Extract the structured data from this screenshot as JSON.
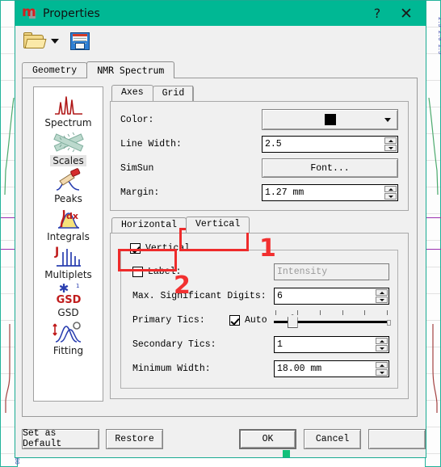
{
  "window": {
    "title": "Properties",
    "logo_icon": "mestrenova-m-logo",
    "help_label": "?",
    "close_label": "✕",
    "titlebar_color": "#00b894",
    "border_color": "#1aab92"
  },
  "toolbar": {
    "open_icon": "open-folder-icon",
    "open_dropdown_icon": "chevron-down-icon",
    "save_icon": "floppy-save-icon"
  },
  "outer_tabs": [
    {
      "label": "Geometry",
      "active": false
    },
    {
      "label": "NMR Spectrum",
      "active": true
    }
  ],
  "sidebar": {
    "items": [
      {
        "label": "Spectrum",
        "icon": "spectrum-icon",
        "selected": false
      },
      {
        "label": "Scales",
        "icon": "scales-ruler-icon",
        "selected": true
      },
      {
        "label": "Peaks",
        "icon": "peaks-hand-icon",
        "selected": false
      },
      {
        "label": "Integrals",
        "icon": "integrals-icon",
        "selected": false
      },
      {
        "label": "Multiplets",
        "icon": "multiplets-icon",
        "selected": false
      },
      {
        "label": "GSD",
        "icon": "gsd-icon",
        "selected": false
      },
      {
        "label": "Fitting",
        "icon": "fitting-icon",
        "selected": false
      }
    ]
  },
  "inner_tabs": [
    {
      "label": "Axes",
      "active": true
    },
    {
      "label": "Grid",
      "active": false
    }
  ],
  "axes": {
    "color": {
      "label": "Color:",
      "value_color": "#000000",
      "caret_icon": "chevron-down-icon"
    },
    "line_width": {
      "label": "Line Width:",
      "value": "2.5"
    },
    "font": {
      "label": "SimSun",
      "button_label": "Font..."
    },
    "margin": {
      "label": "Margin:",
      "value": "1.27 mm"
    }
  },
  "axis_tabs": [
    {
      "label": "Horizontal",
      "active": false
    },
    {
      "label": "Vertical",
      "active": true
    }
  ],
  "vertical": {
    "enabled_label": "Vertical",
    "enabled_checked": true,
    "label_row": {
      "label": "Label:",
      "checked": false,
      "value": "Intensity"
    },
    "max_significant_digits": {
      "label": "Max. Significant Digits:",
      "value": "6"
    },
    "primary_tics": {
      "label": "Primary Tics:",
      "auto_label": "Auto",
      "auto_checked": true,
      "slider_ticks": 6,
      "slider_position_pct": 16
    },
    "secondary_tics": {
      "label": "Secondary Tics:",
      "value": "1"
    },
    "minimum_width": {
      "label": "Minimum Width:",
      "value": "18.00 mm"
    }
  },
  "annotations": [
    {
      "name": "callout-1",
      "text": "1",
      "color": "#f23030"
    },
    {
      "name": "callout-2",
      "text": "2",
      "color": "#f23030"
    }
  ],
  "buttons": {
    "set_as_default": "Set as Default",
    "restore": "Restore",
    "ok": "OK",
    "cancel": "Cancel",
    "extra": ""
  }
}
